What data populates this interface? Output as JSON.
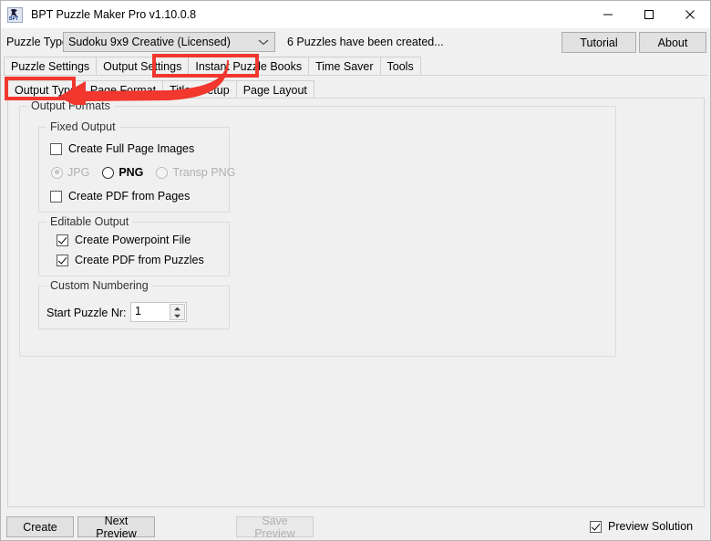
{
  "window": {
    "title": "BPT Puzzle Maker Pro v1.10.0.8",
    "icon": "bpt-app-icon",
    "controls": {
      "minimize": "minimize-icon",
      "maximize": "maximize-icon",
      "close": "close-icon"
    }
  },
  "toolbar": {
    "puzzle_type_label": "Puzzle Type",
    "puzzle_type_value": "Sudoku 9x9 Creative (Licensed)",
    "puzzle_type_options": [
      "Sudoku 9x9 Creative (Licensed)"
    ],
    "status_text": "6 Puzzles have been created...",
    "tutorial_label": "Tutorial",
    "about_label": "About"
  },
  "tabs_primary": [
    {
      "label": "Puzzle Settings",
      "selected": false
    },
    {
      "label": "Output Settings",
      "selected": false
    },
    {
      "label": "Instant Puzzle Books",
      "selected": true
    },
    {
      "label": "Time Saver",
      "selected": false
    },
    {
      "label": "Tools",
      "selected": false
    }
  ],
  "tabs_secondary": [
    {
      "label": "Output Type",
      "selected": true
    },
    {
      "label": "Page Format",
      "selected": false
    },
    {
      "label": "Titles Setup",
      "selected": false
    },
    {
      "label": "Page Layout",
      "selected": false
    }
  ],
  "output_formats": {
    "title": "Output Formats",
    "fixed_output": {
      "title": "Fixed Output",
      "create_full_page_images": {
        "label": "Create Full Page Images",
        "checked": false
      },
      "formats": [
        {
          "label": "JPG",
          "selected": true,
          "enabled": false
        },
        {
          "label": "PNG",
          "selected": false,
          "enabled": true
        },
        {
          "label": "Transp PNG",
          "selected": false,
          "enabled": false
        }
      ],
      "create_pdf_from_pages": {
        "label": "Create PDF from Pages",
        "checked": false
      }
    },
    "editable_output": {
      "title": "Editable Output",
      "create_powerpoint_file": {
        "label": "Create Powerpoint File",
        "checked": true
      },
      "create_pdf_from_puzzles": {
        "label": "Create PDF from Puzzles",
        "checked": true
      }
    },
    "custom_numbering": {
      "title": "Custom Numbering",
      "start_puzzle_label": "Start Puzzle Nr:",
      "start_puzzle_value": "1"
    }
  },
  "bottom_bar": {
    "create_label": "Create",
    "next_preview_label": "Next Preview",
    "save_preview_label": "Save Preview",
    "save_preview_enabled": false,
    "preview_solution": {
      "label": "Preview Solution",
      "checked": true
    }
  },
  "annotations": {
    "highlight_color": "#f1372e",
    "boxes": [
      "Instant Puzzle Books",
      "Output Type"
    ],
    "arrow": "curved-left-arrow"
  }
}
